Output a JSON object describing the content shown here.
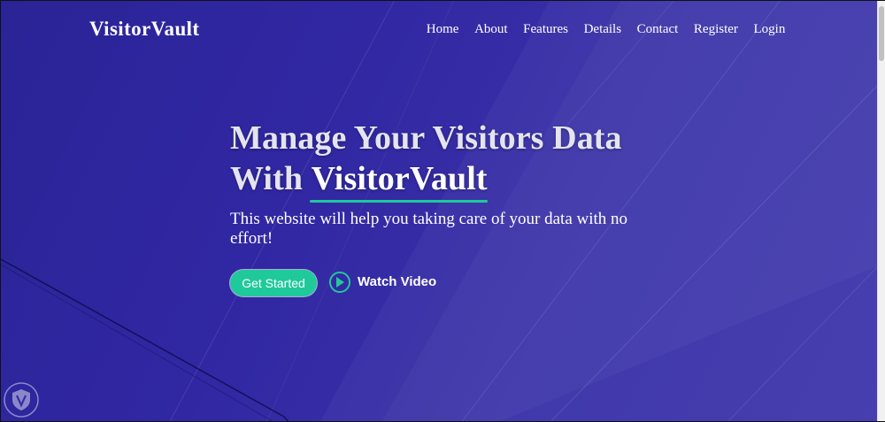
{
  "brand": "VisitorVault",
  "nav": {
    "items": [
      {
        "label": "Home"
      },
      {
        "label": "About"
      },
      {
        "label": "Features"
      },
      {
        "label": "Details"
      },
      {
        "label": "Contact"
      },
      {
        "label": "Register"
      },
      {
        "label": "Login"
      }
    ]
  },
  "hero": {
    "headline_line1": "Manage Your Visitors Data",
    "headline_line2_prefix": "With ",
    "headline_brand": "VisitorVault",
    "subtext": "This website will help you taking care of your data with no effort!",
    "primary_button": "Get Started",
    "secondary_button": "Watch Video",
    "play_icon": "play-circle-icon"
  },
  "colors": {
    "background": "#3127a3",
    "accent": "#1fc99a",
    "text": "#ffffff"
  },
  "watermark_icon": "shield-icon"
}
